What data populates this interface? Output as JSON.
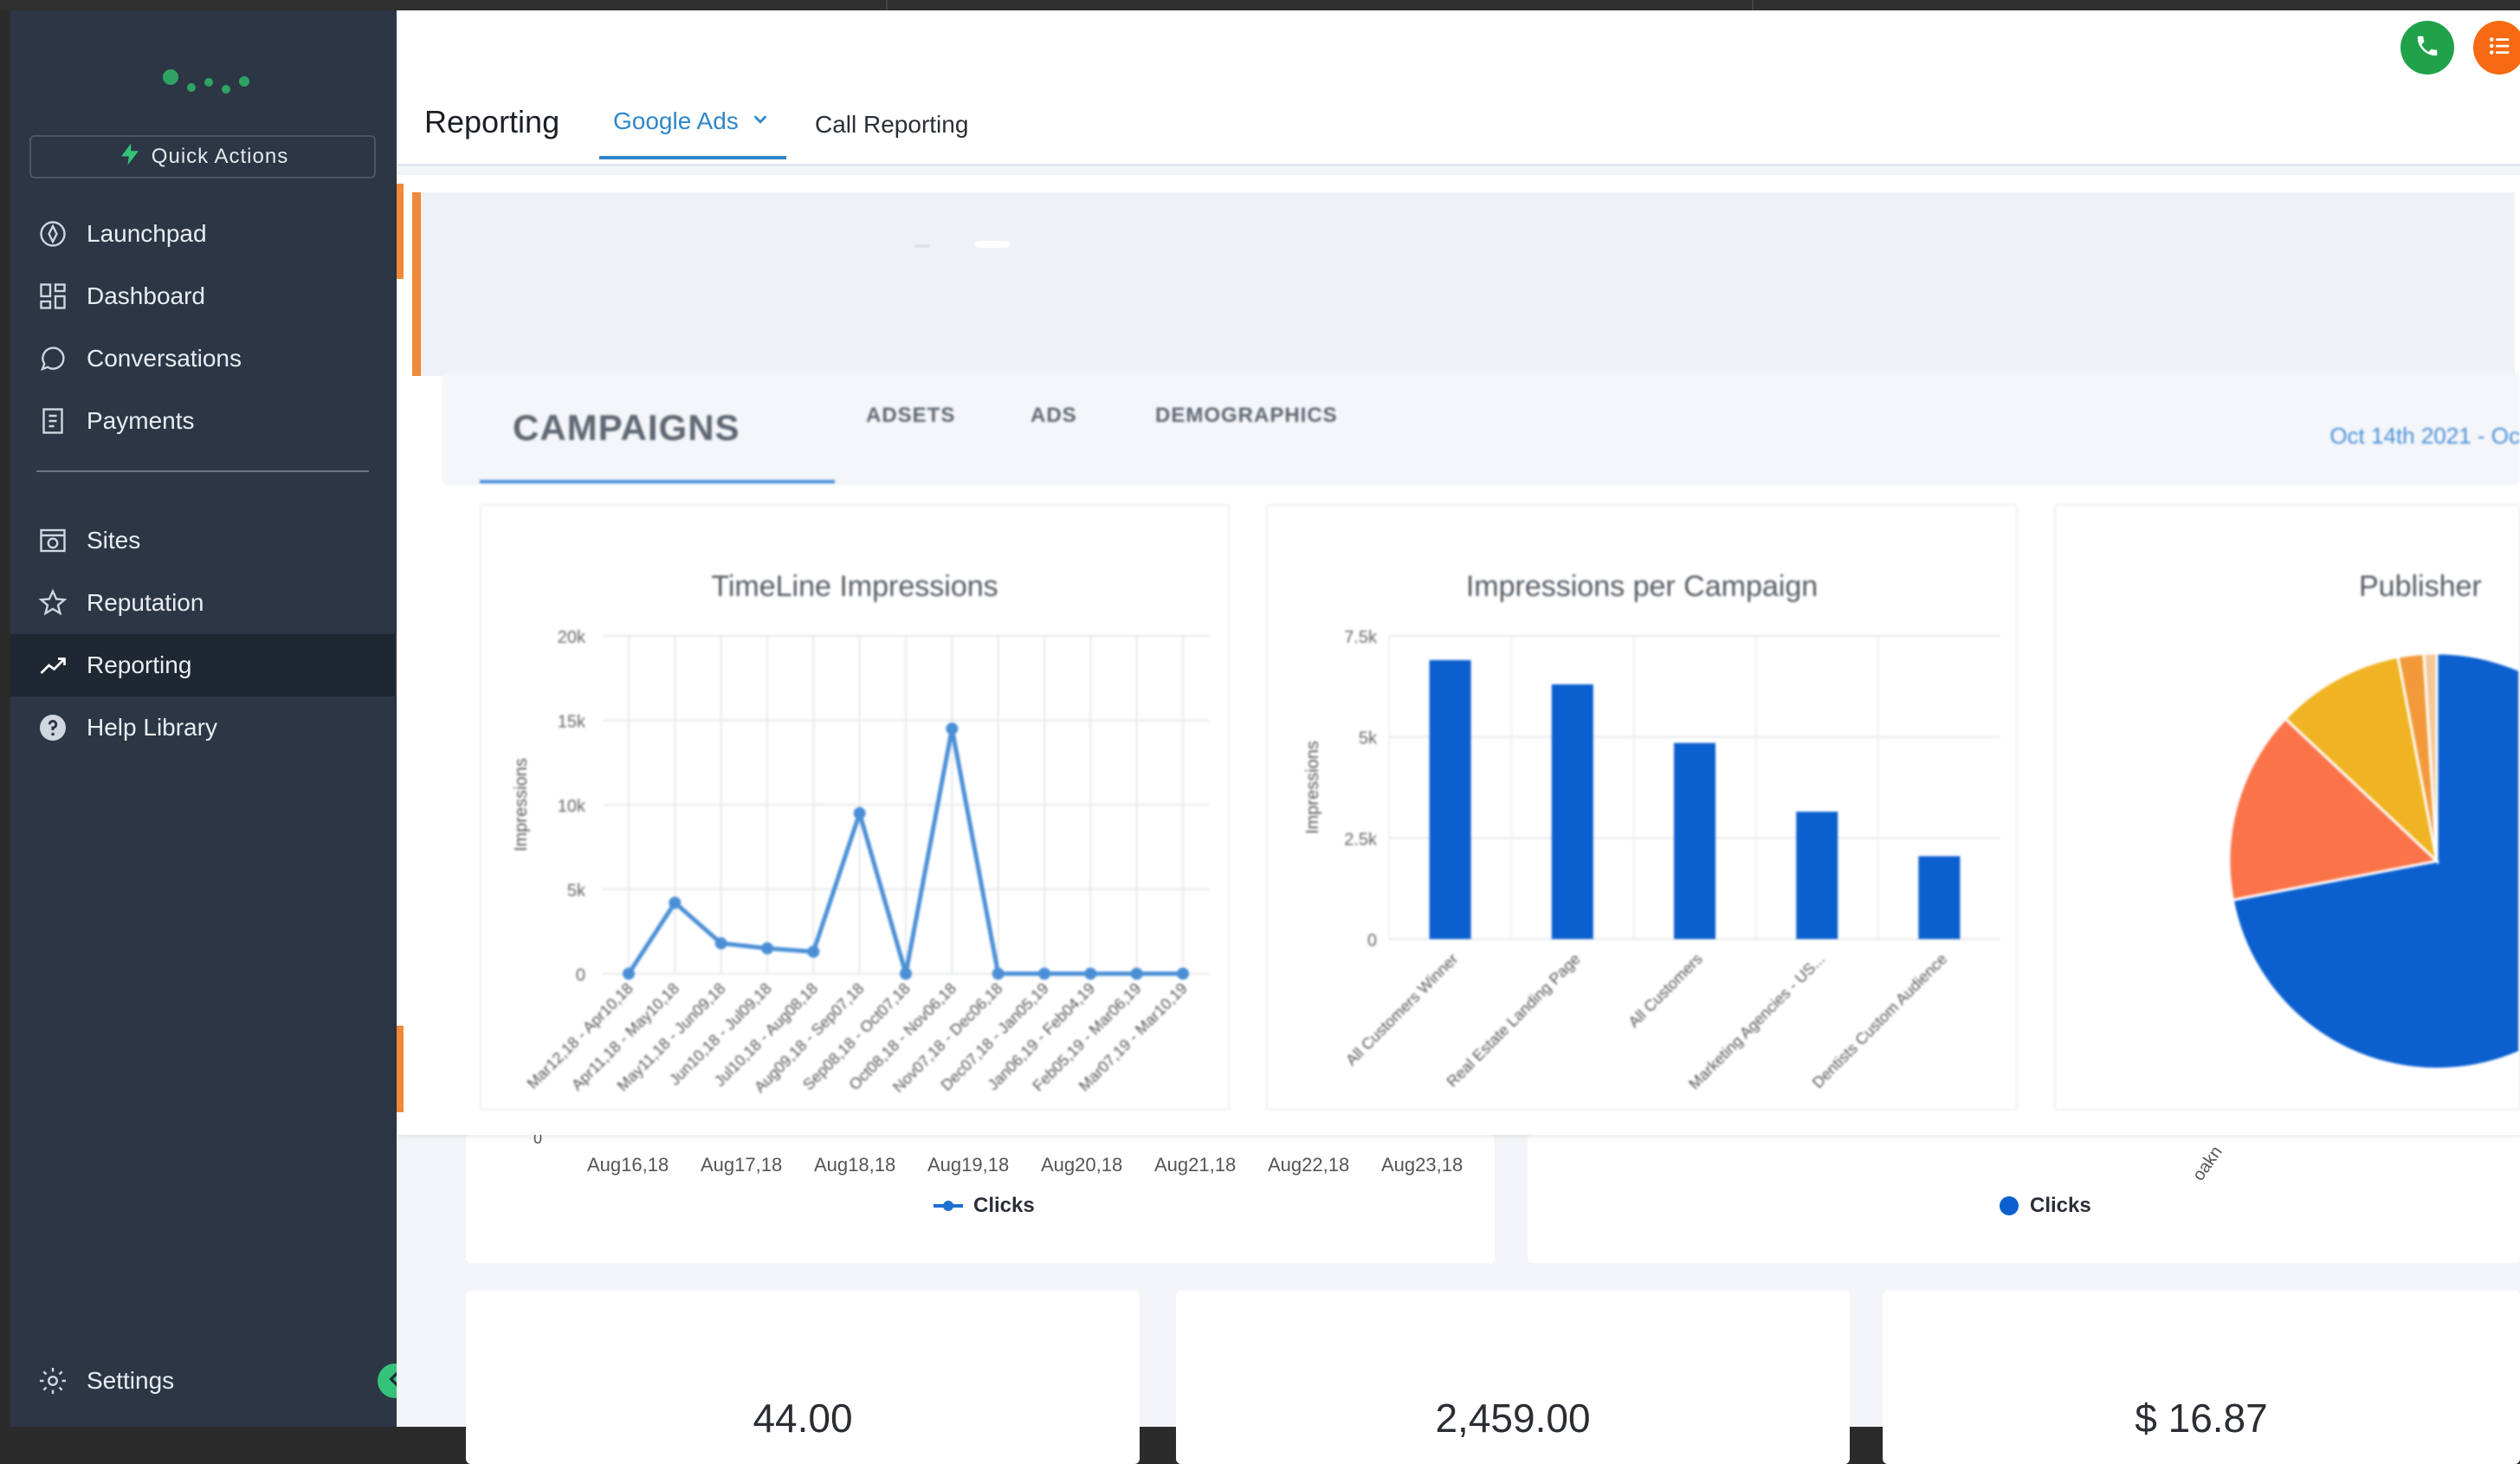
{
  "sidebar": {
    "quick_actions": "Quick Actions",
    "items": [
      {
        "label": "Launchpad",
        "icon": "rocket-icon"
      },
      {
        "label": "Dashboard",
        "icon": "grid-icon"
      },
      {
        "label": "Conversations",
        "icon": "chat-icon"
      },
      {
        "label": "Payments",
        "icon": "receipt-icon"
      },
      {
        "label": "Sites",
        "icon": "globe-icon"
      },
      {
        "label": "Reputation",
        "icon": "star-icon"
      },
      {
        "label": "Reporting",
        "icon": "trending-icon",
        "active": true
      },
      {
        "label": "Help Library",
        "icon": "help-icon"
      }
    ],
    "settings": "Settings"
  },
  "header": {
    "title": "Reporting",
    "tabs": [
      {
        "label": "Google Ads",
        "active": true,
        "has_dropdown": true
      },
      {
        "label": "Call Reporting"
      }
    ],
    "phone_color": "#1fa24a",
    "menu_color": "#f56a12"
  },
  "campaign_tabs": [
    "CAMPAIGNS",
    "ADSETS",
    "ADS",
    "DEMOGRAPHICS"
  ],
  "date_range": "Oct 14th 2021 - Oc",
  "lower": {
    "x_ticks": [
      "Aug16,18",
      "Aug17,18",
      "Aug18,18",
      "Aug19,18",
      "Aug20,18",
      "Aug21,18",
      "Aug22,18",
      "Aug23,18"
    ],
    "zero_label": "0",
    "partial_label": "oakn",
    "legend_left": "Clicks",
    "legend_right": "Clicks"
  },
  "stats": [
    "44.00",
    "2,459.00",
    "$ 16.87"
  ],
  "chart_data": [
    {
      "type": "line",
      "title": "TimeLine Impressions",
      "ylabel": "Impressions",
      "ylim": [
        0,
        20000
      ],
      "yticks": [
        "0",
        "5k",
        "10k",
        "15k",
        "20k"
      ],
      "categories": [
        "Mar12,18 - Apr10,18",
        "Apr11,18 - May10,18",
        "May11,18 - Jun09,18",
        "Jun10,18 - Jul09,18",
        "Jul10,18 - Aug08,18",
        "Aug09,18 - Sep07,18",
        "Sep08,18 - Oct07,18",
        "Oct08,18 - Nov06,18",
        "Nov07,18 - Dec06,18",
        "Dec07,18 - Jan05,19",
        "Jan06,19 - Feb04,19",
        "Feb05,19 - Mar06,19",
        "Mar07,19 - Mar10,19"
      ],
      "values": [
        0,
        4200,
        1800,
        1500,
        1300,
        9500,
        0,
        14500,
        0,
        0,
        0,
        0,
        0
      ],
      "color": "#4a8fd6"
    },
    {
      "type": "bar",
      "title": "Impressions per Campaign",
      "ylabel": "Impressions",
      "ylim": [
        0,
        7500
      ],
      "yticks": [
        "0",
        "2.5k",
        "5k",
        "7.5k"
      ],
      "categories": [
        "All Customers Winner",
        "Real Estate Landing Page",
        "All Customers",
        "Marketing Agencies - US...",
        "Dentists Custom Audience"
      ],
      "values": [
        6900,
        6300,
        4850,
        3150,
        2050
      ],
      "color": "#0b5fcf"
    },
    {
      "type": "pie",
      "title": "Publisher",
      "values": [
        72,
        15,
        10,
        2,
        1
      ],
      "colors": [
        "#0b5fcf",
        "#fb7449",
        "#f0b323",
        "#f29a3a",
        "#f5c89a"
      ]
    }
  ]
}
